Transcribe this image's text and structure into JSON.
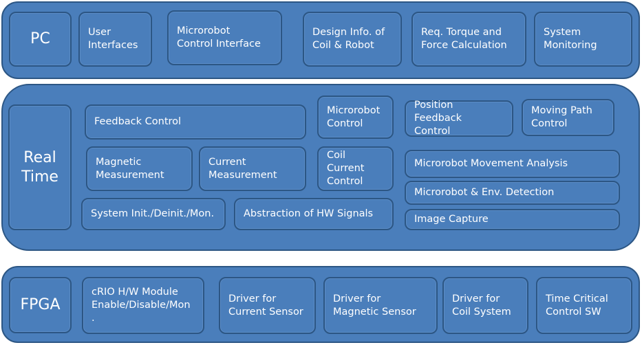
{
  "layers": {
    "pc": {
      "label": "PC",
      "items": [
        "User\nInterfaces",
        "Microrobot\nControl Interface",
        "Design Info. of\nCoil & Robot",
        "Req. Torque and\nForce Calculation",
        "System\nMonitoring"
      ]
    },
    "realtime": {
      "label": "Real\nTime",
      "items": [
        "Feedback Control",
        "Microrobot\nControl",
        "Position Feedback\nControl",
        "Moving Path\nControl",
        "Magnetic\nMeasurement",
        "Current\nMeasurement",
        "Coil\nCurrent\nControl",
        "Microrobot Movement Analysis",
        "Microrobot & Env. Detection",
        "Image Capture",
        "System Init./Deinit./Mon.",
        "Abstraction of HW Signals"
      ]
    },
    "fpga": {
      "label": "FPGA",
      "items": [
        "cRIO H/W Module\nEnable/Disable/Mon\n.",
        "Driver for\nCurrent Sensor",
        "Driver for\nMagnetic Sensor",
        "Driver for\nCoil System",
        "Time Critical\nControl SW"
      ]
    }
  },
  "colors": {
    "fill": "#4a7ebb",
    "border": "#2c5684",
    "text": "#ffffff"
  }
}
